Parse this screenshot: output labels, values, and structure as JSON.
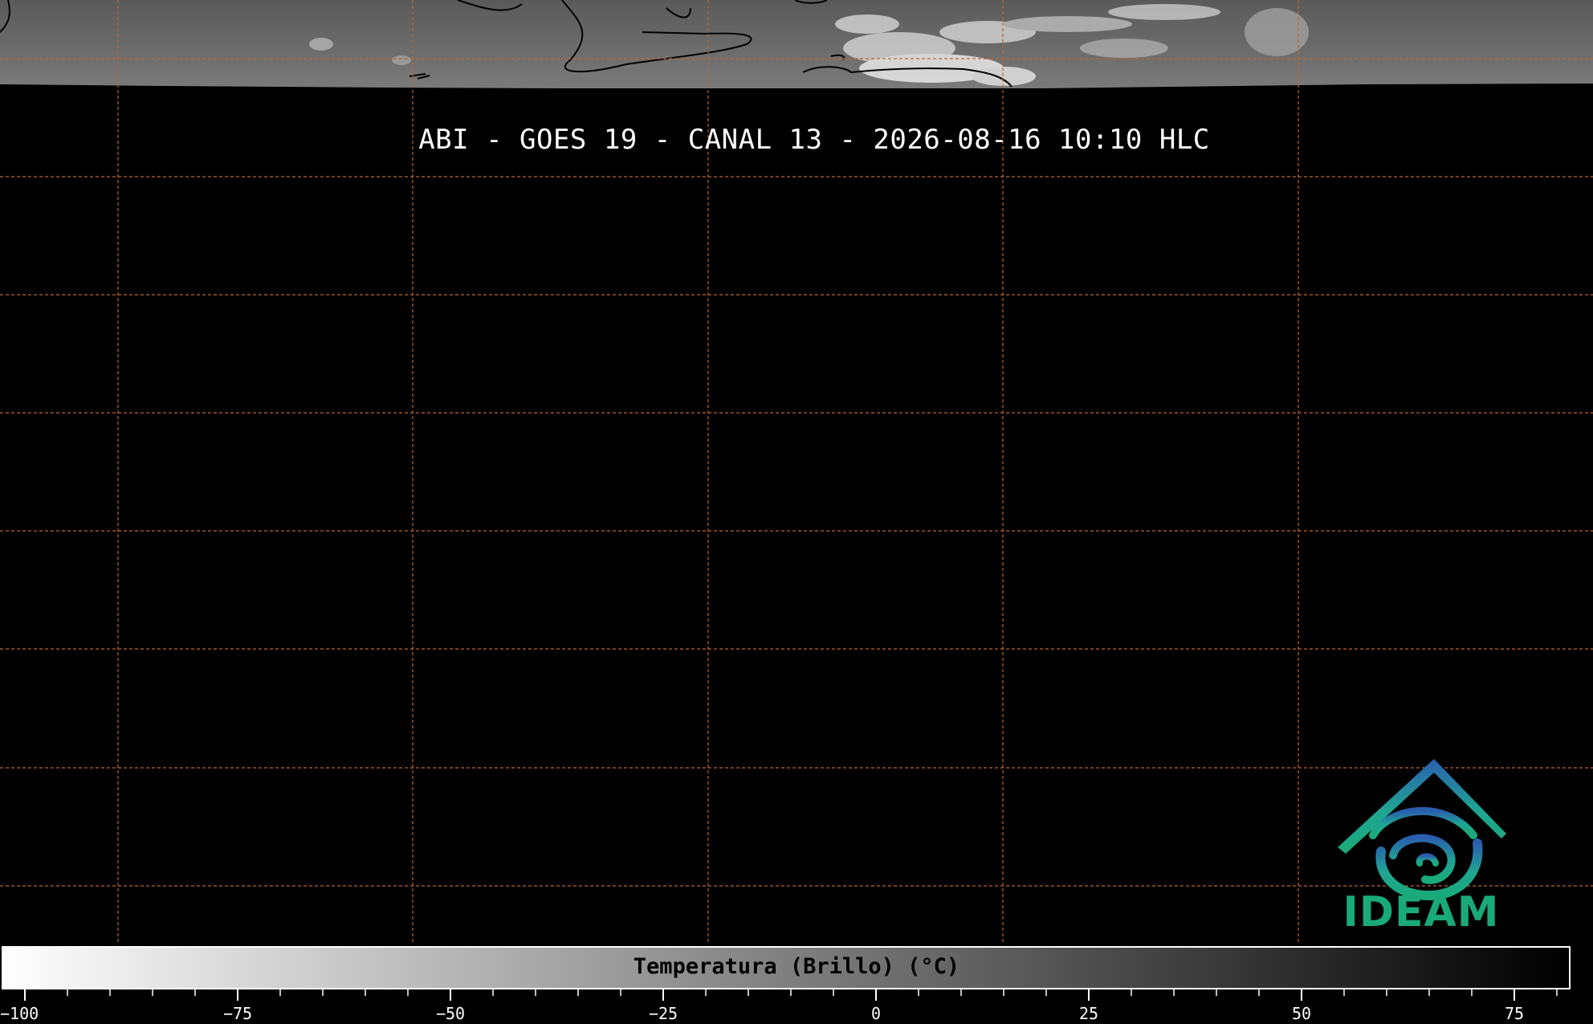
{
  "title": "ABI - GOES 19 - CANAL 13 - 2026-08-16 10:10 HLC",
  "logo": {
    "text": "IDEAM",
    "icon": "ideam-logo-icon",
    "colors": {
      "blue": "#2a6fb8",
      "teal": "#1fa592",
      "green": "#1aaa7a"
    }
  },
  "grid": {
    "color": "#c0652a",
    "style": "dashed"
  },
  "colorbar": {
    "label": "Temperatura (Brillo) (°C)",
    "min": -100,
    "max": 85,
    "major_ticks": [
      {
        "value": -100,
        "label": "−100"
      },
      {
        "value": -75,
        "label": "−75"
      },
      {
        "value": -50,
        "label": "−50"
      },
      {
        "value": -25,
        "label": "−25"
      },
      {
        "value": 0,
        "label": "0"
      },
      {
        "value": 25,
        "label": "25"
      },
      {
        "value": 50,
        "label": "50"
      },
      {
        "value": 75,
        "label": "75"
      }
    ],
    "minor_step": 5,
    "gradient": {
      "cold": "#ffffff",
      "warm": "#000000"
    }
  }
}
